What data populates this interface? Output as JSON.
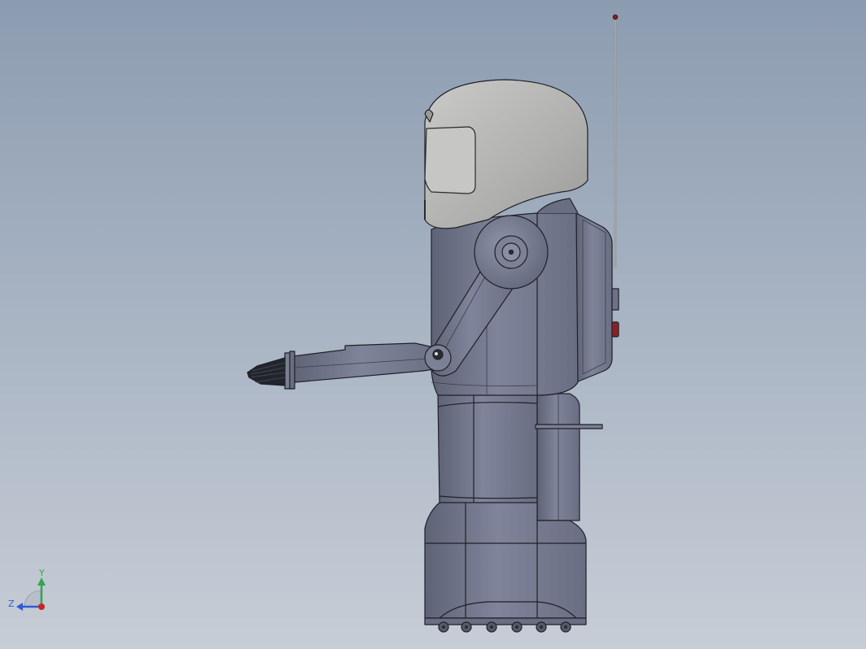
{
  "viewport": {
    "background_top": "#8c9cb0",
    "background_bottom": "#c7cdd6",
    "model": {
      "name": "robot",
      "body_color": "#7b7f92",
      "helmet_color": "#b2b2b0",
      "outline_color": "#1e2028",
      "antenna_tip_color": "#8b1d1d"
    }
  },
  "triad": {
    "y_label": "Y",
    "z_label": "Z",
    "y_color": "#2fa84f",
    "z_color": "#2f5cd4",
    "x_color": "#cc2222"
  }
}
